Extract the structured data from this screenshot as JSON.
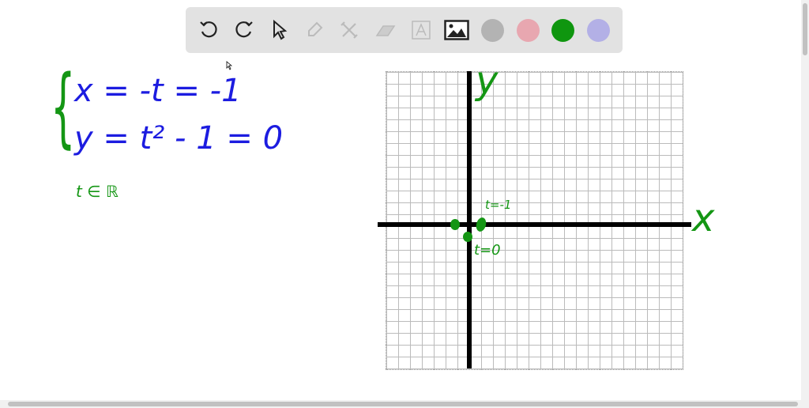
{
  "toolbar": {
    "tools": [
      "undo",
      "redo",
      "select",
      "pen",
      "tools",
      "eraser",
      "text",
      "image"
    ],
    "colors": [
      "#b3b3b3",
      "#e8a7b0",
      "#0f960f",
      "#b3b0e6"
    ]
  },
  "board": {
    "eq_brace": "{",
    "eq1": "x = -t = -1",
    "eq2": "y = t² - 1 = 0",
    "domain": "t ∈ ℝ",
    "y_label": "y",
    "x_label": "x",
    "label_t_neg1": "t=-1",
    "label_t_0": "t=0"
  },
  "colors": {
    "blue": "#1c1ce0",
    "green": "#149614"
  }
}
